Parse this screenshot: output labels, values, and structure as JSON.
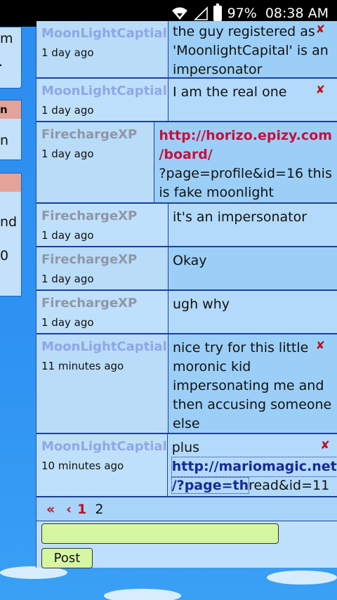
{
  "status_bar": {
    "battery": "97%",
    "time": "08:38 AM"
  },
  "sidebar_fragments": {
    "panel1": [
      "m",
      "."
    ],
    "panel2_header": "n",
    "panel2_text": "n",
    "panel3_text": [
      "nd",
      "0"
    ]
  },
  "posts": [
    {
      "user": "MoonLightCaptial",
      "time": "1 day ago",
      "lines": [
        "the guy registered as",
        "'MoonlightCapital' is an",
        "impersonator"
      ],
      "deletable": true
    },
    {
      "user": "MoonLightCaptial",
      "time": "1 day ago",
      "lines": [
        "I am the real one"
      ],
      "deletable": true
    },
    {
      "user": "FirechargeXP",
      "time": "1 day ago",
      "link_lines": [
        "http://horizo.epizy.com",
        "/board/"
      ],
      "lines": [
        "?page=profile&id=16 this",
        "is fake moonlight"
      ],
      "deletable": false
    },
    {
      "user": "FirechargeXP",
      "time": "1 day ago",
      "lines": [
        "it's an impersonator"
      ],
      "deletable": false
    },
    {
      "user": "FirechargeXP",
      "time": "1 day ago",
      "lines": [
        "Okay"
      ],
      "deletable": false
    },
    {
      "user": "FirechargeXP",
      "time": "1 day ago",
      "lines": [
        "ugh why"
      ],
      "deletable": false
    },
    {
      "user": "MoonLightCaptial",
      "time": "11 minutes ago",
      "lines": [
        "nice try for this little",
        "moronic kid",
        "impersonating me and",
        "then accusing someone",
        "else"
      ],
      "deletable": true
    },
    {
      "user": "MoonLightCaptial",
      "time": "10 minutes ago",
      "pre": "plus",
      "link_line1": "http://mariomagic.net",
      "link_line2_link": "/?page=th",
      "link_line2_rest": "read&id=11",
      "deletable": true
    }
  ],
  "pagination": {
    "first": "«",
    "prev": "‹",
    "current": "1",
    "next_page": "2"
  },
  "reply": {
    "input_value": "",
    "post_label": "Post"
  },
  "delete_glyph": "✘",
  "colors": {
    "moon_user": "#8fa6e8",
    "fire_user": "#8f97a5",
    "link_red": "#c4123c",
    "link_blue": "#172a93",
    "input_bg": "#d7f6a2"
  }
}
